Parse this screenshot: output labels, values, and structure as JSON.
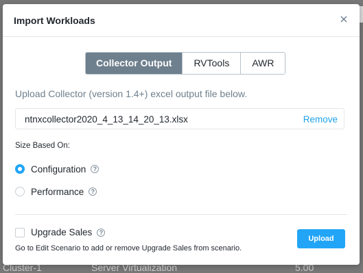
{
  "background": {
    "row_cluster": "Cluster-1",
    "row_type": "Server Virtualization",
    "row_value": "5.00"
  },
  "modal": {
    "title": "Import Workloads",
    "close_icon": "close-icon",
    "tabs": [
      {
        "label": "Collector Output",
        "active": true
      },
      {
        "label": "RVTools",
        "active": false
      },
      {
        "label": "AWR",
        "active": false
      }
    ],
    "instruction": "Upload Collector (version 1.4+) excel output file below.",
    "file": {
      "name": "ntnxcollector2020_4_13_14_20_13.xlsx",
      "remove_label": "Remove"
    },
    "size_based_on": {
      "label": "Size Based On:",
      "options": [
        {
          "label": "Configuration",
          "checked": true
        },
        {
          "label": "Performance",
          "checked": false
        }
      ]
    },
    "upgrade_sales": {
      "label": "Upgrade Sales",
      "checked": false,
      "note": "Go to Edit Scenario to add or remove Upgrade Sales from scenario."
    },
    "upload_label": "Upload"
  },
  "colors": {
    "accent": "#22a5f7",
    "segment_active": "#6e7f8d",
    "link": "#1fa3e6"
  }
}
